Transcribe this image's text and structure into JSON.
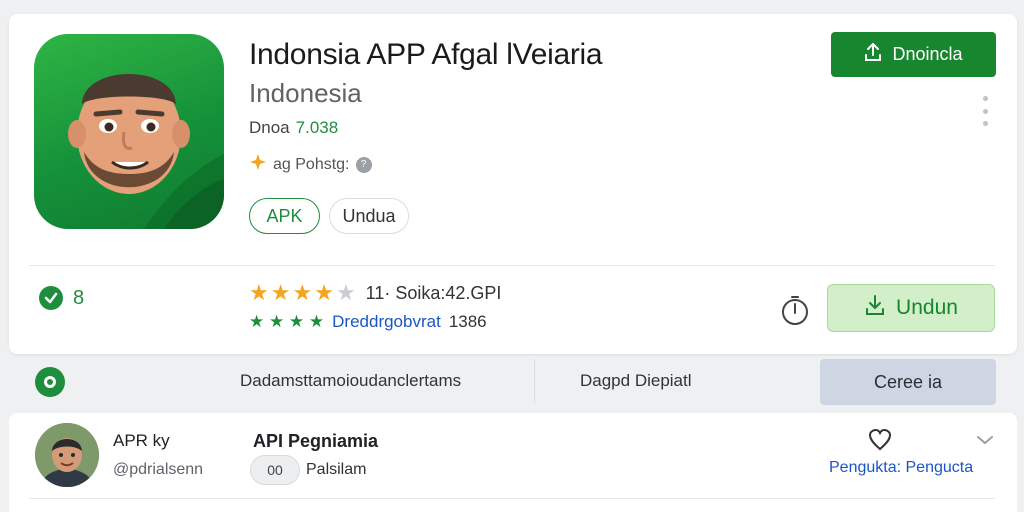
{
  "app": {
    "title": "Indonsia APP Afgal lVeiaria",
    "developer": "Indonesia",
    "downloads_label": "Dnoa",
    "downloads_value": "7.038",
    "policy_text": "ag Pohstg:",
    "policy_info": "?",
    "chips": [
      "APK",
      "Undua"
    ],
    "download_button": "Dnoincla"
  },
  "stats": {
    "badge_count": "8",
    "rating_stars": 4,
    "rating_max": 5,
    "rating_text": "11· Soika:42.GPI",
    "review_stars": "★ ★ ★ ★",
    "review_link": "Dreddrgobvrat",
    "review_count": "1386",
    "undun_button": "Undun"
  },
  "tabs": {
    "tab1": "Dadamsttamoioudanclertams",
    "tab2": "Dagpd Diepiatl",
    "tab3": "Ceree ia"
  },
  "comment": {
    "user_name": "APR ky",
    "user_handle": "@pdrialsenn",
    "title": "API Pegniamia",
    "pill": "00",
    "pill_label": "Palsilam",
    "footer_link": "Pengukta: Pengucta"
  },
  "colors": {
    "accent_green": "#18862e",
    "link_blue": "#1a56c4",
    "star_gold": "#f4a51c"
  },
  "icons": {
    "download": "upload-arrow-icon",
    "more": "kebab-menu-icon",
    "timer": "stopwatch-icon",
    "heart": "heart-outline-icon",
    "chevron": "chevron-down-icon"
  }
}
